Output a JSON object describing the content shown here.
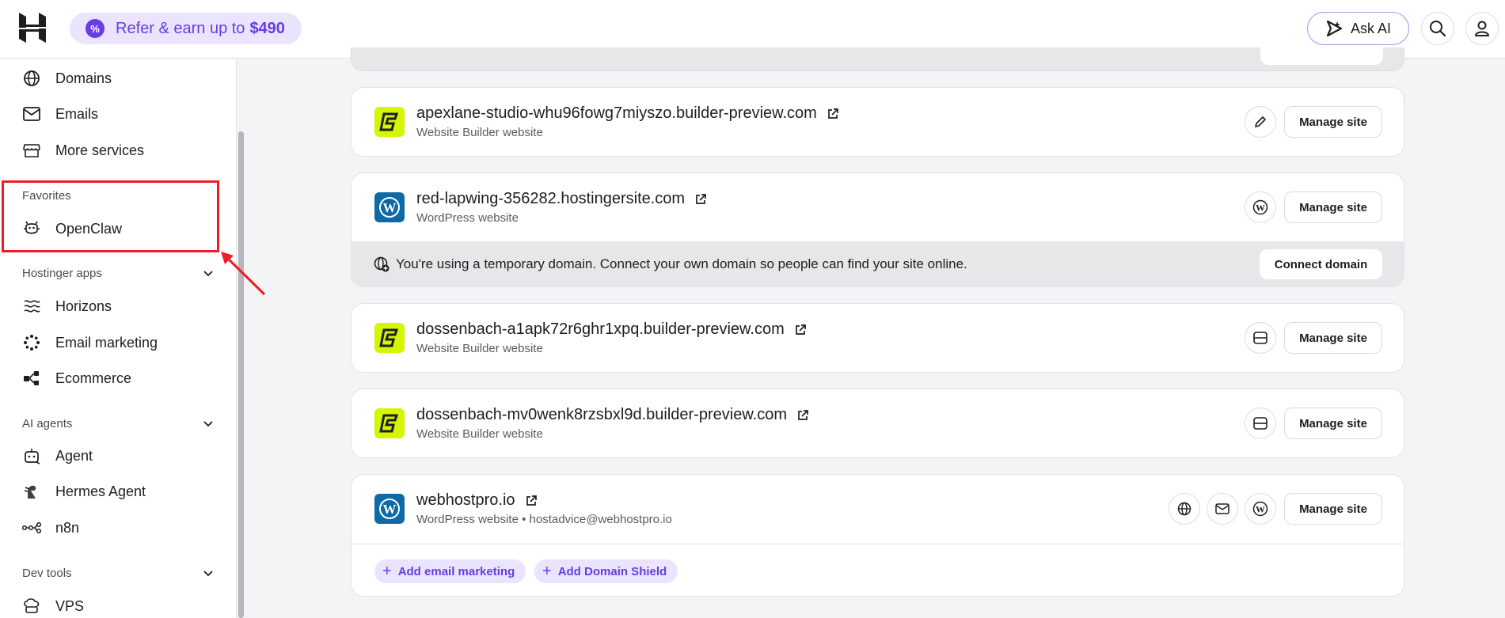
{
  "header": {
    "refer_prefix": "Refer & earn up to",
    "refer_amount": "$490",
    "ask_ai_label": "Ask AI"
  },
  "sidebar": {
    "items_top": [
      {
        "label": "Domains",
        "icon": "globe-icon"
      },
      {
        "label": "Emails",
        "icon": "mail-icon"
      },
      {
        "label": "More services",
        "icon": "store-icon"
      }
    ],
    "favorites": {
      "title": "Favorites",
      "items": [
        {
          "label": "OpenClaw",
          "icon": "claw-icon"
        }
      ]
    },
    "hostinger_apps": {
      "title": "Hostinger apps",
      "items": [
        {
          "label": "Horizons",
          "icon": "horizons-icon"
        },
        {
          "label": "Email marketing",
          "icon": "email-marketing-icon"
        },
        {
          "label": "Ecommerce",
          "icon": "ecommerce-icon"
        }
      ]
    },
    "ai_agents": {
      "title": "AI agents",
      "items": [
        {
          "label": "Agent",
          "icon": "robot-icon"
        },
        {
          "label": "Hermes Agent",
          "icon": "hermes-icon"
        },
        {
          "label": "n8n",
          "icon": "n8n-icon"
        }
      ]
    },
    "dev_tools": {
      "title": "Dev tools",
      "items": [
        {
          "label": "VPS",
          "icon": "cloud-server-icon"
        }
      ]
    }
  },
  "sites": [
    {
      "name": "apexlane-studio-whu96fowg7miyszo.builder-preview.com",
      "type": "Website Builder website",
      "manage_label": "Manage site"
    },
    {
      "name": "red-lapwing-356282.hostingersite.com",
      "type": "WordPress website",
      "manage_label": "Manage site",
      "notice": "You're using a temporary domain. Connect your own domain so people can find your site online.",
      "connect_label": "Connect domain"
    },
    {
      "name": "dossenbach-a1apk72r6ghr1xpq.builder-preview.com",
      "type": "Website Builder website",
      "manage_label": "Manage site"
    },
    {
      "name": "dossenbach-mv0wenk8rzsbxl9d.builder-preview.com",
      "type": "Website Builder website",
      "manage_label": "Manage site"
    },
    {
      "name": "webhostpro.io",
      "type": "WordPress website • hostadvice@webhostpro.io",
      "manage_label": "Manage site",
      "add_email_marketing": "Add email marketing",
      "add_domain_shield": "Add Domain Shield"
    }
  ],
  "colors": {
    "accent": "#673de6",
    "builder_logo": "#d4f600",
    "wp_logo": "#0e6aa6",
    "highlight": "#ee1c24"
  }
}
